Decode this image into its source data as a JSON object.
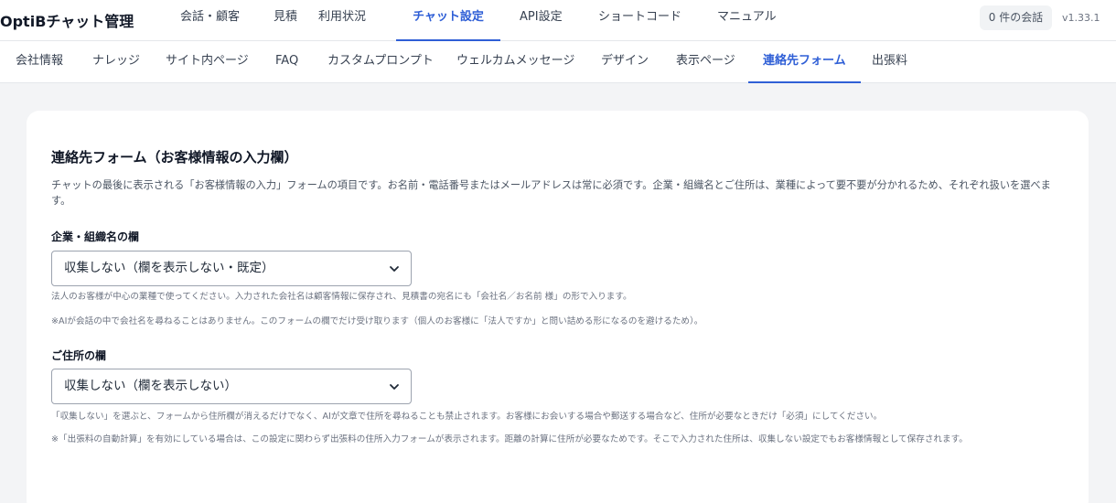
{
  "header": {
    "brand": "OptiBチャット管理",
    "nav": [
      {
        "label": "会話・顧客"
      },
      {
        "label": "見積"
      },
      {
        "label": "利用状況"
      },
      {
        "label": "チャット設定"
      },
      {
        "label": "API設定"
      },
      {
        "label": "ショートコード"
      },
      {
        "label": "マニュアル"
      }
    ],
    "active_nav": "チャット設定",
    "session_badge": "0 件の会話",
    "version": "v1.33.1"
  },
  "subnav": {
    "items": [
      {
        "label": "会社情報"
      },
      {
        "label": "ナレッジ"
      },
      {
        "label": "サイト内ページ"
      },
      {
        "label": "FAQ"
      },
      {
        "label": "カスタムプロンプト"
      },
      {
        "label": "ウェルカムメッセージ"
      },
      {
        "label": "デザイン"
      },
      {
        "label": "表示ページ"
      },
      {
        "label": "連絡先フォーム"
      },
      {
        "label": "出張料"
      }
    ],
    "active": "連絡先フォーム"
  },
  "form": {
    "title": "連絡先フォーム（お客様情報の入力欄）",
    "description": "チャットの最後に表示される「お客様情報の入力」フォームの項目です。お名前・電話番号またはメールアドレスは常に必須です。企業・組織名とご住所は、業種によって要不要が分かれるため、それぞれ扱いを選べます。",
    "company_field": {
      "label": "企業・組織名の欄",
      "selected": "収集しない（欄を表示しない・既定）",
      "note1": "法人のお客様が中心の業種で使ってください。入力された会社名は顧客情報に保存され、見積書の宛名にも「会社名／お名前 様」の形で入ります。",
      "note2": "※AIが会話の中で会社名を尋ねることはありません。このフォームの欄でだけ受け取ります（個人のお客様に「法人ですか」と問い詰める形になるのを避けるため）。"
    },
    "address_field": {
      "label": "ご住所の欄",
      "selected": "収集しない（欄を表示しない）",
      "note1": "「収集しない」を選ぶと、フォームから住所欄が消えるだけでなく、AIが文章で住所を尋ねることも禁止されます。お客様にお会いする場合や郵送する場合など、住所が必要なときだけ「必須」にしてください。",
      "note2": "※「出張料の自動計算」を有効にしている場合は、この設定に関わらず出張料の住所入力フォームが表示されます。距離の計算に住所が必要なためです。そこで入力された住所は、収集しない設定でもお客様情報として保存されます。"
    }
  },
  "colors": {
    "accent": "#2f5fd6",
    "background": "#f3f4f6"
  }
}
